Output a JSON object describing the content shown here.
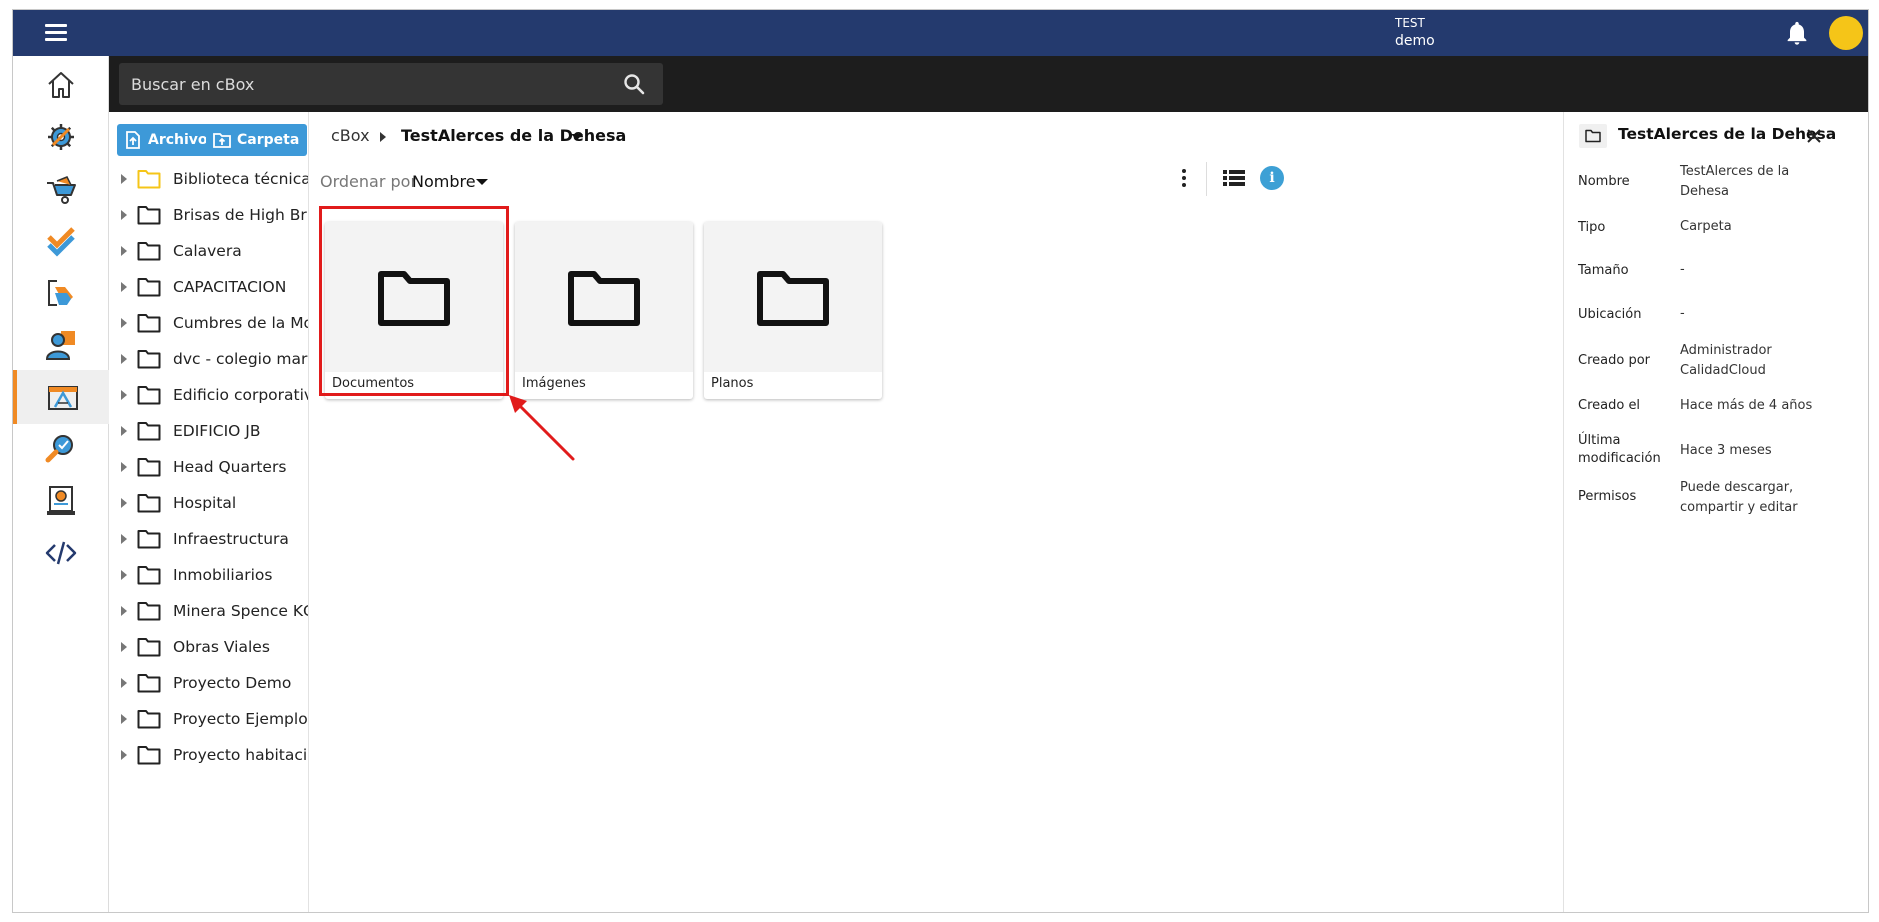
{
  "header": {
    "user_line1": "TEST",
    "user_line2": "demo"
  },
  "search": {
    "placeholder": "Buscar en cBox"
  },
  "tree": {
    "upload_files_label": "Archivos",
    "upload_folder_label": "Carpeta",
    "items": [
      {
        "label": "Biblioteca técnica",
        "folder_color": "#f5c518"
      },
      {
        "label": "Brisas de High Bridge"
      },
      {
        "label": "Calavera"
      },
      {
        "label": "CAPACITACION"
      },
      {
        "label": "Cumbres de la Molina"
      },
      {
        "label": "dvc - colegio markham"
      },
      {
        "label": "Edificio corporativo Inn"
      },
      {
        "label": "EDIFICIO JB"
      },
      {
        "label": "Head Quarters"
      },
      {
        "label": "Hospital"
      },
      {
        "label": "Infraestructura"
      },
      {
        "label": "Inmobiliarios"
      },
      {
        "label": "Minera Spence KGM"
      },
      {
        "label": "Obras Viales"
      },
      {
        "label": "Proyecto Demo"
      },
      {
        "label": "Proyecto Ejemplo jb"
      },
      {
        "label": "Proyecto habitacional"
      }
    ]
  },
  "breadcrumb": {
    "root": "cBox",
    "current": "TestAlerces de la Dehesa"
  },
  "sort": {
    "label": "Ordenar por",
    "value": "Nombre"
  },
  "folders": [
    {
      "label": "Documentos",
      "highlighted": true
    },
    {
      "label": "Imágenes"
    },
    {
      "label": "Planos"
    }
  ],
  "details": {
    "title": "TestAlerces de la Dehesa",
    "props": [
      {
        "key": "Nombre",
        "value": "TestAlerces de la Dehesa"
      },
      {
        "key": "Tipo",
        "value": "Carpeta"
      },
      {
        "key": "Tamaño",
        "value": "-"
      },
      {
        "key": "Ubicación",
        "value": "-"
      },
      {
        "key": "Creado por",
        "value": "Administrador CalidadCloud"
      },
      {
        "key": "Creado el",
        "value": "Hace más de 4 años"
      },
      {
        "key": "Última modificación",
        "value": "Hace 3 meses"
      },
      {
        "key": "Permisos",
        "value": "Puede descargar, compartir y editar"
      }
    ]
  },
  "colors": {
    "topbar": "#243a6e",
    "accent_blue": "#3d99d8",
    "accent_orange": "#f08a24",
    "highlight_red": "#e11b1b",
    "avatar": "#f5c518"
  },
  "rail_icons": [
    "home-icon",
    "settings-gear-icon",
    "wheelbarrow-icon",
    "checklist-icon",
    "transfer-icon",
    "users-icon",
    "plans-icon",
    "inspection-icon",
    "certificate-icon",
    "code-icon"
  ]
}
